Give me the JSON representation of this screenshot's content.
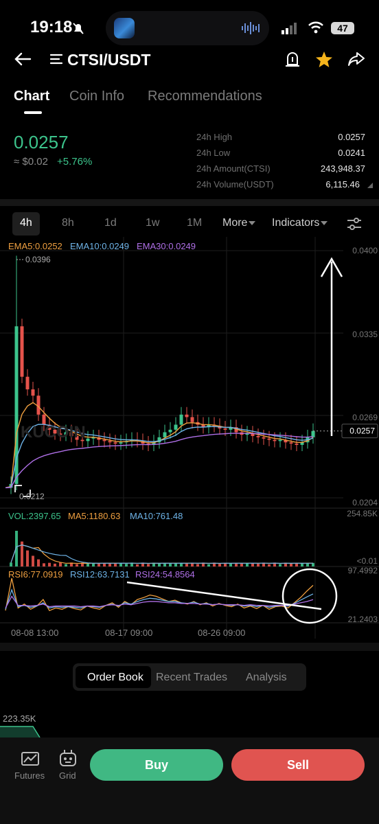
{
  "status_bar": {
    "time": "19:18",
    "battery": "47"
  },
  "header": {
    "pair": "CTSI/USDT"
  },
  "top_tabs": [
    "Chart",
    "Coin Info",
    "Recommendations"
  ],
  "ticker": {
    "price": "0.0257",
    "approx_usd": "≈ $0.02",
    "change": "+5.76%",
    "stats": [
      {
        "label": "24h High",
        "value": "0.0257"
      },
      {
        "label": "24h Low",
        "value": "0.0241"
      },
      {
        "label": "24h Amount(CTSI)",
        "value": "243,948.37"
      },
      {
        "label": "24h Volume(USDT)",
        "value": "6,115.46"
      }
    ]
  },
  "chart_toolbar": {
    "intervals": [
      "4h",
      "8h",
      "1d",
      "1w",
      "1M"
    ],
    "more": "More",
    "indicators": "Indicators"
  },
  "chart_data": {
    "type": "line",
    "main": {
      "legend": [
        {
          "label": "EMA5:0.0252",
          "color": "#f0a040"
        },
        {
          "label": "EMA10:0.0249",
          "color": "#6fb4e8"
        },
        {
          "label": "EMA30:0.0249",
          "color": "#b070e8"
        }
      ],
      "y_ticks": [
        "0.0400",
        "0.0335",
        "0.0269",
        "0.0204"
      ],
      "current_price": "0.0257",
      "max_label": "0.0396",
      "min_label": "0.0212",
      "watermark": "KUCOIN",
      "ylim": [
        0.0204,
        0.04
      ],
      "closes": [
        0.0212,
        0.0215,
        0.034,
        0.03,
        0.029,
        0.0285,
        0.027,
        0.0262,
        0.0258,
        0.0255,
        0.0254,
        0.0256,
        0.0253,
        0.025,
        0.0249,
        0.0251,
        0.0252,
        0.025,
        0.0249,
        0.0248,
        0.0247,
        0.0248,
        0.0249,
        0.025,
        0.0249,
        0.0247,
        0.0246,
        0.0248,
        0.0252,
        0.0256,
        0.0258,
        0.0262,
        0.027,
        0.0268,
        0.0264,
        0.0262,
        0.026,
        0.0262,
        0.0261,
        0.0259,
        0.0258,
        0.026,
        0.0256,
        0.0254,
        0.0255,
        0.0253,
        0.0252,
        0.0251,
        0.025,
        0.0249,
        0.025,
        0.0248,
        0.0247,
        0.0246,
        0.0248,
        0.0252,
        0.0257
      ]
    },
    "volume": {
      "legend": [
        {
          "label": "VOL:2397.65",
          "color": "#3cc48c"
        },
        {
          "label": "MA5:1180.63",
          "color": "#f0a040"
        },
        {
          "label": "MA10:761.48",
          "color": "#6fb4e8"
        }
      ],
      "y_ticks": [
        "254.85K",
        "<0.01"
      ],
      "ylim": [
        0,
        254850
      ]
    },
    "rsi": {
      "legend": [
        {
          "label": "RSI6:77.0919",
          "color": "#f0a040"
        },
        {
          "label": "RSI12:63.7131",
          "color": "#6fb4e8"
        },
        {
          "label": "RSI24:54.8564",
          "color": "#b070e8"
        }
      ],
      "y_ticks": [
        "97.4992",
        "21.2403"
      ],
      "ylim": [
        21.2403,
        97.4992
      ],
      "rsi6": [
        38,
        88,
        42,
        48,
        40,
        45,
        55,
        38,
        42,
        40,
        44,
        41,
        39,
        45,
        42,
        40,
        46,
        50,
        43,
        52,
        47,
        55,
        58,
        62,
        60,
        56,
        52,
        54,
        50,
        48,
        52,
        47,
        50,
        45,
        49,
        46,
        44,
        48,
        42,
        45,
        41,
        46,
        40,
        44,
        45,
        42,
        50,
        58,
        68,
        77
      ],
      "rsi12": [
        40,
        70,
        44,
        46,
        43,
        45,
        50,
        42,
        44,
        43,
        44,
        43,
        42,
        45,
        44,
        43,
        46,
        48,
        45,
        50,
        48,
        52,
        55,
        57,
        56,
        54,
        52,
        52,
        50,
        49,
        51,
        48,
        49,
        47,
        48,
        47,
        46,
        47,
        45,
        46,
        44,
        46,
        43,
        45,
        46,
        45,
        49,
        54,
        59,
        63.7
      ],
      "rsi24": [
        42,
        60,
        46,
        46,
        45,
        46,
        48,
        44,
        45,
        45,
        45,
        45,
        44,
        45,
        45,
        44,
        46,
        47,
        46,
        48,
        47,
        49,
        51,
        52,
        52,
        51,
        50,
        50,
        49,
        49,
        49,
        48,
        48,
        47,
        48,
        47,
        47,
        47,
        46,
        47,
        46,
        46,
        45,
        46,
        46,
        46,
        48,
        50,
        52,
        54.9
      ]
    },
    "x_ticks": [
      "08-08 13:00",
      "08-17 09:00",
      "08-26 09:00"
    ]
  },
  "bottom_tabs": [
    "Order Book",
    "Recent Trades",
    "Analysis"
  ],
  "depth_label": "223.35K",
  "bottom_nav": {
    "futures": "Futures",
    "grid": "Grid"
  },
  "actions": {
    "buy": "Buy",
    "sell": "Sell"
  },
  "colors": {
    "up": "#3cc48c",
    "down": "#e5534b",
    "buy": "#40b883",
    "sell": "#e05450"
  }
}
